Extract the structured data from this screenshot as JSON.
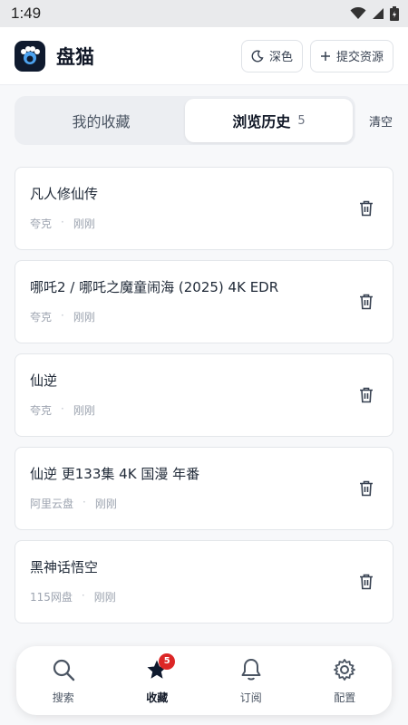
{
  "status_bar": {
    "time": "1:49"
  },
  "header": {
    "app_name": "盘猫",
    "theme_button": "深色",
    "submit_button": "提交资源"
  },
  "tabs": [
    {
      "label": "我的收藏",
      "active": false
    },
    {
      "label": "浏览历史",
      "count": "5",
      "active": true
    }
  ],
  "clear_label": "清空",
  "history": [
    {
      "title": "凡人修仙传",
      "source": "夸克",
      "sep": "·",
      "time": "刚刚"
    },
    {
      "title": "哪吒2 / 哪吒之魔童闹海 (2025) 4K EDR",
      "source": "夸克",
      "sep": "·",
      "time": "刚刚"
    },
    {
      "title": "仙逆",
      "source": "夸克",
      "sep": "·",
      "time": "刚刚"
    },
    {
      "title": "仙逆 更133集 4K 国漫 年番",
      "source": "阿里云盘",
      "sep": "·",
      "time": "刚刚"
    },
    {
      "title": "黑神话悟空",
      "source": "115网盘",
      "sep": "·",
      "time": "刚刚"
    }
  ],
  "bottom_nav": [
    {
      "label": "搜索",
      "icon": "search-icon",
      "active": false
    },
    {
      "label": "收藏",
      "icon": "star-icon",
      "active": true,
      "badge": "5"
    },
    {
      "label": "订阅",
      "icon": "bell-icon",
      "active": false
    },
    {
      "label": "配置",
      "icon": "gear-icon",
      "active": false
    }
  ],
  "colors": {
    "accent_dark": "#0f1a2e",
    "badge": "#dc2626",
    "logo_paw": "#4da3f0"
  }
}
